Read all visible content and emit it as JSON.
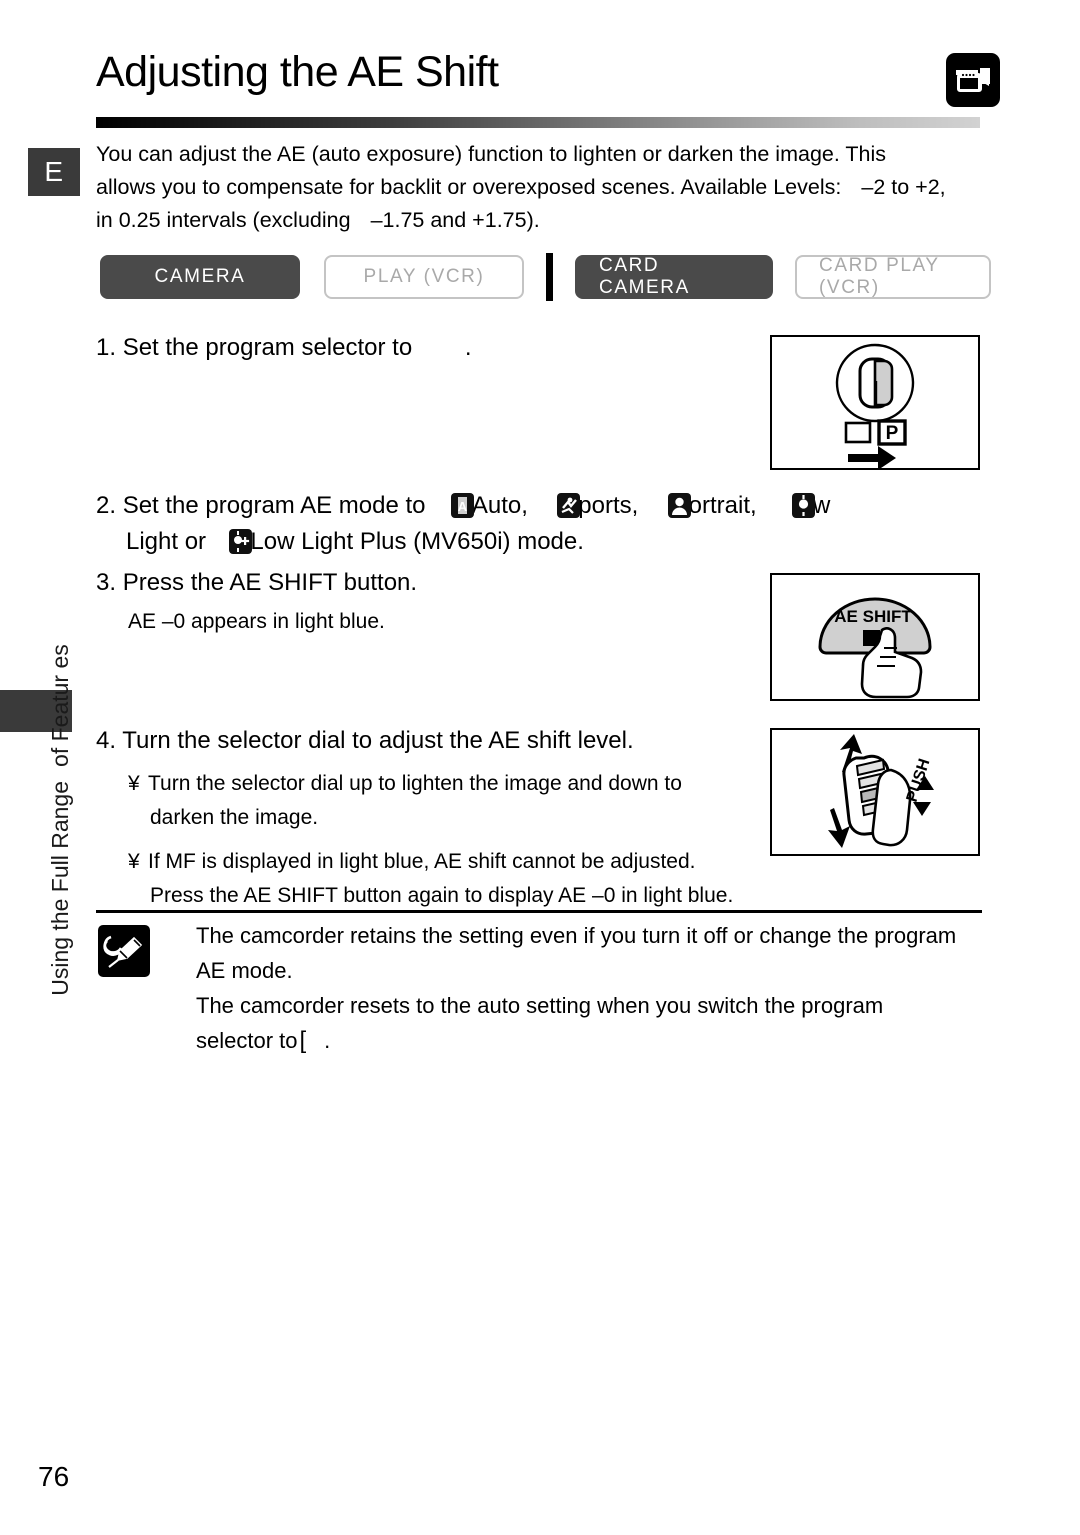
{
  "document": {
    "language_tab": "E",
    "page_number": "76",
    "side_label_line1": "Using the Full Range",
    "side_label_line2": "of Featur es"
  },
  "header": {
    "title": "Adjusting the AE Shift",
    "icon": "camcorder-icon"
  },
  "intro": {
    "line1": "You can adjust the AE (auto exposure) function to lighten or darken the image. This",
    "line2a": "allows you to compensate for backlit or overexposed scenes. Available Levels:",
    "line2b": "–2 to +2,",
    "line3a": "in 0.25 intervals (excluding",
    "line3b": "–1.75 and +1.75)."
  },
  "modes": [
    {
      "label": "CAMERA",
      "active": true
    },
    {
      "label": "PLAY (VCR)",
      "active": false
    },
    {
      "label": "CARD CAMERA",
      "active": true
    },
    {
      "label": "CARD PLAY (VCR)",
      "active": false
    }
  ],
  "steps": {
    "step1": {
      "number": "1.",
      "text_before": "Set the program selector to",
      "text_after": "."
    },
    "step2": {
      "number": "2.",
      "line1_before": "Set the program AE mode to",
      "line1_auto": "Auto,",
      "line1_sports": "ports,",
      "line1_portrait": "ortrait,",
      "line1_low": "w",
      "line2_before": "Light or",
      "line2_after": "Low Light Plus (MV650i) mode."
    },
    "step3": {
      "number": "3.",
      "text": "Press the AE SHIFT button.",
      "note": "AE –0  appears in light blue."
    },
    "step4": {
      "number": "4.",
      "text": "Turn the selector dial to adjust the AE shift level.",
      "bullet1_line1": "Turn the selector dial up to lighten the image and down to",
      "bullet1_line2": "darken the image.",
      "bullet2_line1": "If  MF  is displayed in light blue, AE shift cannot be adjusted.",
      "bullet2_line2": "Press the AE SHIFT button again to display  AE –0  in light blue."
    }
  },
  "figures": {
    "fig1": {
      "name": "program-selector-dial",
      "p_label": "P"
    },
    "fig2": {
      "name": "ae-shift-button",
      "button_label": "AE SHIFT"
    },
    "fig3": {
      "name": "selector-dial",
      "push_label": "PUSH"
    }
  },
  "note": {
    "icon": "pencil-note-icon",
    "line1": "The camcorder retains the setting even if you turn it off or change the program",
    "line2": "AE mode.",
    "line3": "The camcorder resets to the auto setting when you switch the program",
    "line4a": "selector to",
    "line4b": "."
  },
  "colors": {
    "active_chip": "#4a4a4a",
    "inactive_text": "#a9a9a9",
    "inactive_border": "#c4c4c4",
    "tab_dark": "#3a3a3a"
  }
}
